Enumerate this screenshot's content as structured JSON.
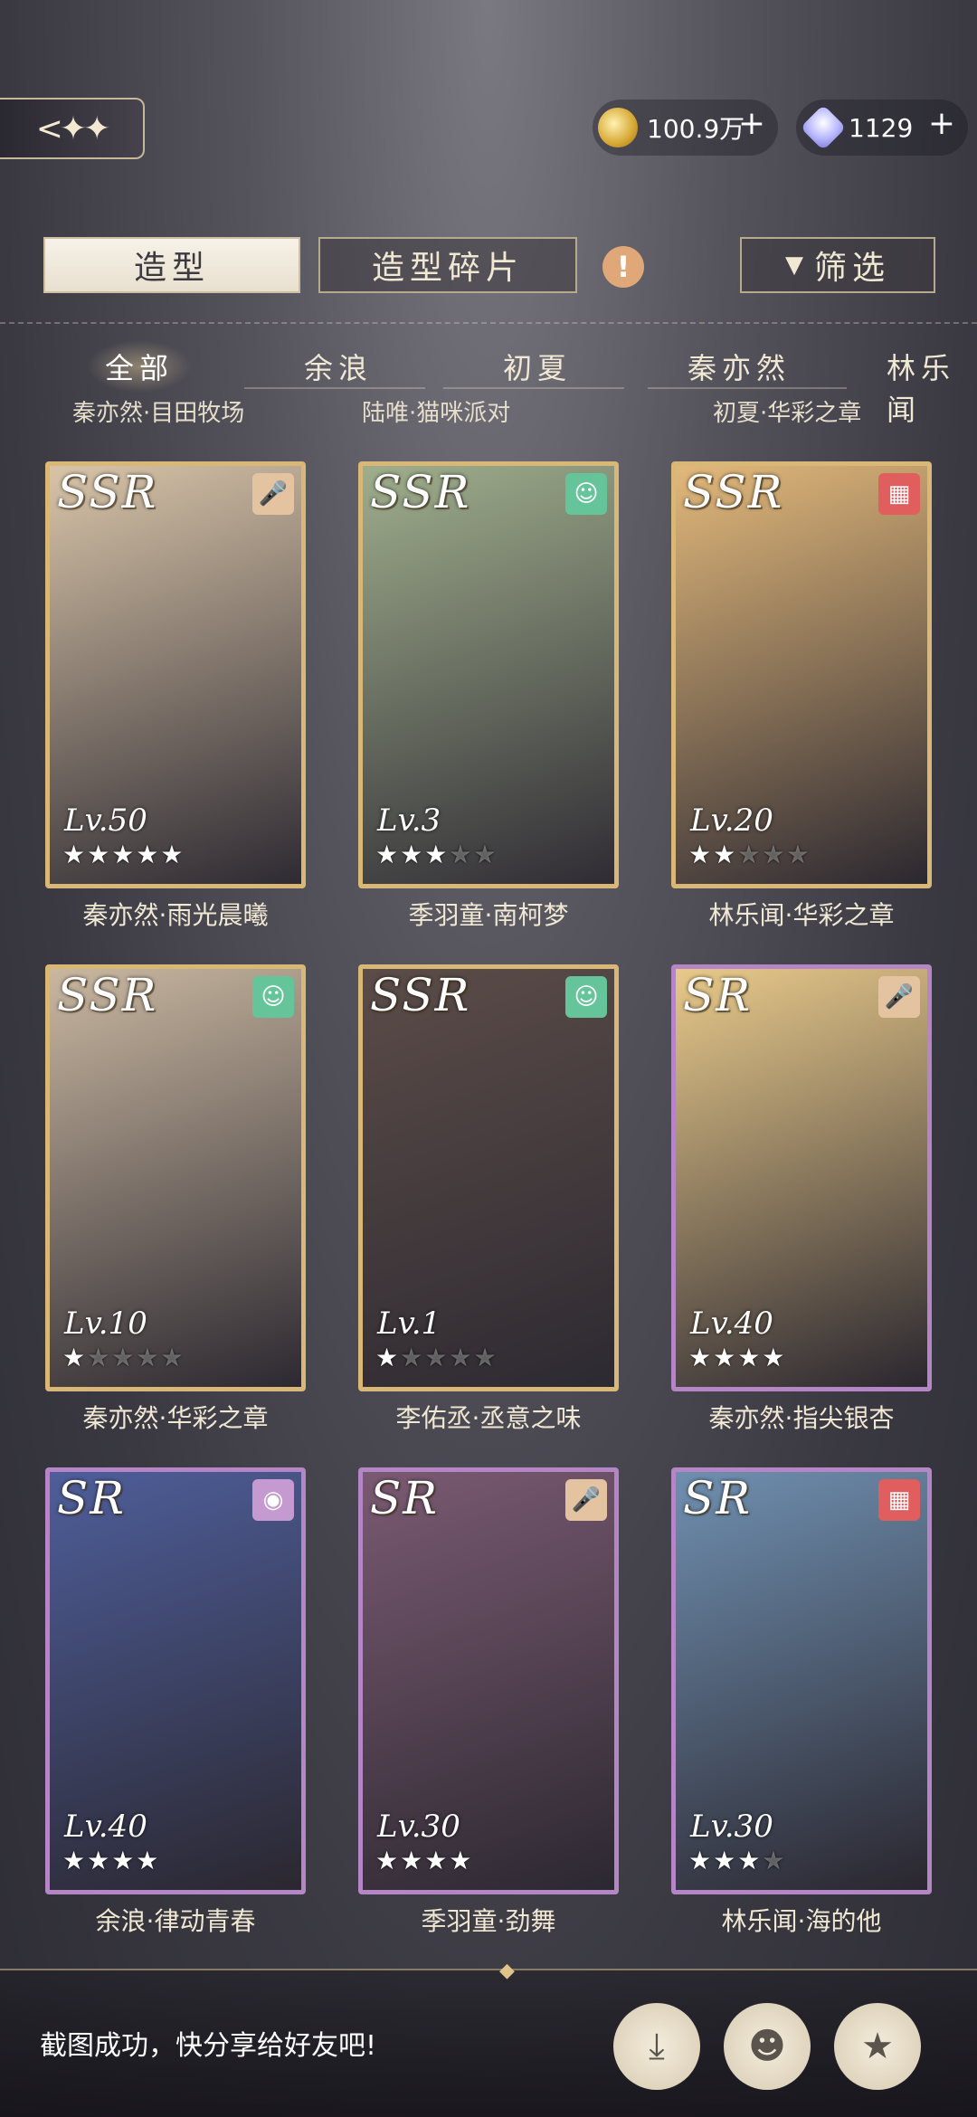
{
  "header": {
    "back_icon": "back-arrow-sparkle-icon",
    "coins": "100.9万",
    "gems": "1129",
    "plus": "+"
  },
  "tabs": {
    "model": "造型",
    "fragments": "造型碎片",
    "alert": "!",
    "filter": "筛选"
  },
  "characters": [
    "全部",
    "余浪",
    "初夏",
    "秦亦然",
    "林乐闻"
  ],
  "subtitles": [
    "秦亦然·目田牧场",
    "陆唯·猫咪派对",
    "初夏·华彩之章"
  ],
  "cards": [
    {
      "rarity": "SSR",
      "level": "Lv.50",
      "stars": 5,
      "max_stars": 5,
      "badge": "mic-icon",
      "caption": "秦亦然·雨光晨曦",
      "art": "#d8c4a8"
    },
    {
      "rarity": "SSR",
      "level": "Lv.3",
      "stars": 3,
      "max_stars": 5,
      "badge": "smile-icon",
      "caption": "季羽童·南柯梦",
      "art": "#9fae8c"
    },
    {
      "rarity": "SSR",
      "level": "Lv.20",
      "stars": 2,
      "max_stars": 5,
      "badge": "film-icon",
      "caption": "林乐闻·华彩之章",
      "art": "#e2b87a"
    },
    {
      "rarity": "SSR",
      "level": "Lv.10",
      "stars": 1,
      "max_stars": 5,
      "badge": "smile-icon",
      "caption": "秦亦然·华彩之章",
      "art": "#c9b7a0"
    },
    {
      "rarity": "SSR",
      "level": "Lv.1",
      "stars": 1,
      "max_stars": 5,
      "badge": "smile-icon",
      "caption": "李佑丞·丞意之味",
      "art": "#5b4c48"
    },
    {
      "rarity": "SR",
      "level": "Lv.40",
      "stars": 4,
      "max_stars": 4,
      "badge": "mic-icon",
      "caption": "秦亦然·指尖银杏",
      "art": "#e8c98a"
    },
    {
      "rarity": "SR",
      "level": "Lv.40",
      "stars": 4,
      "max_stars": 4,
      "badge": "disc-icon",
      "caption": "余浪·律动青春",
      "art": "#4e5e9a"
    },
    {
      "rarity": "SR",
      "level": "Lv.30",
      "stars": 4,
      "max_stars": 4,
      "badge": "mic-icon",
      "caption": "季羽童·劲舞",
      "art": "#7a5a72"
    },
    {
      "rarity": "SR",
      "level": "Lv.30",
      "stars": 3,
      "max_stars": 4,
      "badge": "film-icon",
      "caption": "林乐闻·海的他",
      "art": "#6f8fb0"
    }
  ],
  "toast": {
    "message": "截图成功，快分享给好友吧!",
    "actions": [
      "download-icon",
      "qq-icon",
      "qzone-icon"
    ]
  }
}
